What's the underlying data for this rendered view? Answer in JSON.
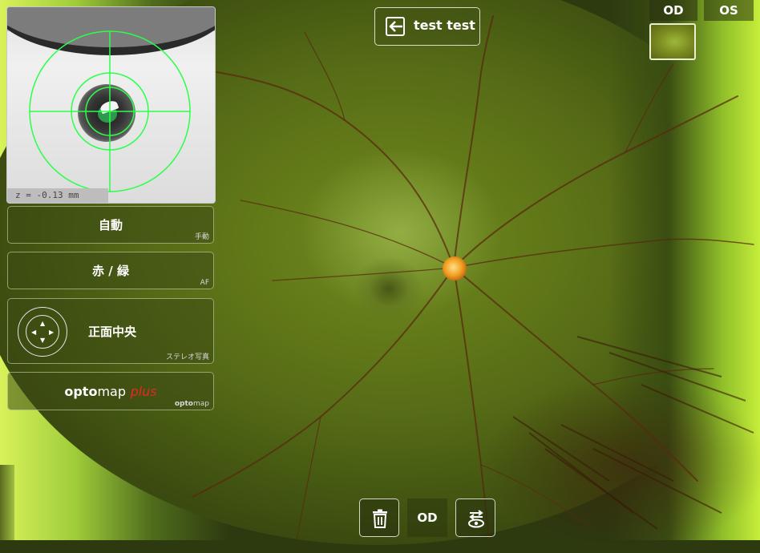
{
  "patient": {
    "name": "test test"
  },
  "eye_tabs": [
    {
      "label": "OD",
      "selected": true
    },
    {
      "label": "OS",
      "selected": false
    }
  ],
  "eye_camera": {
    "z_readout": "z = -0.13 mm"
  },
  "left_panel": {
    "focus_mode": {
      "main": "自動",
      "sub": "手動"
    },
    "color_mode": {
      "main": "赤 / 緑",
      "sub": "AF"
    },
    "target": {
      "main": "正面中央",
      "sub": "ステレオ写真"
    },
    "optomap": {
      "main_bold": "opto",
      "main_light": "map",
      "main_plus": "plus",
      "sub_bold": "opto",
      "sub_light": "map"
    }
  },
  "bottom_bar": {
    "eye_label": "OD"
  },
  "icons": {
    "exit": "exit-icon",
    "delete": "trash-icon",
    "switch": "eye-swap-icon",
    "joystick": "direction-pad-icon"
  },
  "colors": {
    "accent_green": "#2cff4a",
    "optomap_plus_red": "#e8281e",
    "disc_orange": "#f0a020"
  }
}
